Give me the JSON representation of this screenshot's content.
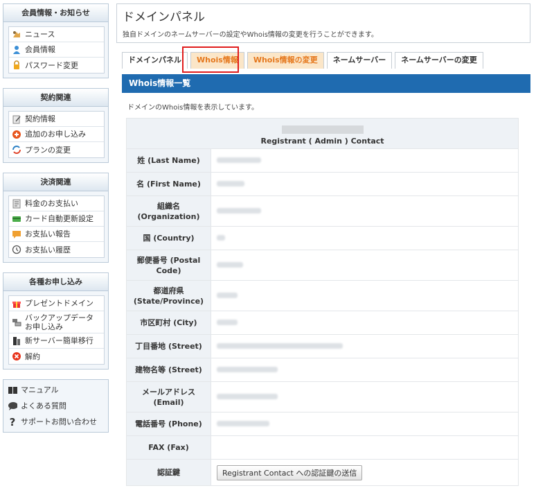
{
  "sidebar": {
    "sections": [
      {
        "title": "会員情報・お知らせ",
        "items": [
          {
            "label": "ニュース",
            "icon": "news-icon"
          },
          {
            "label": "会員情報",
            "icon": "user-icon"
          },
          {
            "label": "パスワード変更",
            "icon": "lock-icon"
          }
        ]
      },
      {
        "title": "契約関連",
        "items": [
          {
            "label": "契約情報",
            "icon": "contract-icon"
          },
          {
            "label": "追加のお申し込み",
            "icon": "add-icon"
          },
          {
            "label": "プランの変更",
            "icon": "refresh-icon"
          }
        ]
      },
      {
        "title": "決済関連",
        "items": [
          {
            "label": "料金のお支払い",
            "icon": "invoice-icon"
          },
          {
            "label": "カード自動更新設定",
            "icon": "card-icon"
          },
          {
            "label": "お支払い報告",
            "icon": "report-icon"
          },
          {
            "label": "お支払い履歴",
            "icon": "history-icon"
          }
        ]
      },
      {
        "title": "各種お申し込み",
        "items": [
          {
            "label": "プレゼントドメイン",
            "icon": "gift-icon"
          },
          {
            "label": "バックアップデータ\nお申し込み",
            "icon": "backup-icon"
          },
          {
            "label": "新サーバー簡単移行",
            "icon": "server-icon"
          },
          {
            "label": "解約",
            "icon": "cancel-icon"
          }
        ]
      }
    ],
    "support": [
      {
        "label": "マニュアル",
        "icon": "book-icon"
      },
      {
        "label": "よくある質問",
        "icon": "faq-icon"
      },
      {
        "label": "サポートお問い合わせ",
        "icon": "question-icon"
      }
    ]
  },
  "header": {
    "title": "ドメインパネル",
    "description": "独自ドメインのネームサーバーの設定やWhois情報の変更を行うことができます。"
  },
  "tabs": [
    {
      "label": "ドメインパネル"
    },
    {
      "label": "Whois情報"
    },
    {
      "label": "Whois情報の変更"
    },
    {
      "label": "ネームサーバー"
    },
    {
      "label": "ネームサーバーの変更"
    }
  ],
  "panel": {
    "title": "Whois情報一覧",
    "description": "ドメインのWhois情報を表示しています。"
  },
  "whois": {
    "contact_heading": "Registrant ( Admin ) Contact",
    "rows": [
      {
        "label": "姓 (Last Name)"
      },
      {
        "label": "名 (First Name)"
      },
      {
        "label": "組織名 (Organization)"
      },
      {
        "label": "国 (Country)"
      },
      {
        "label": "郵便番号 (Postal Code)"
      },
      {
        "label": "都道府県 (State/Province)"
      },
      {
        "label": "市区町村 (City)"
      },
      {
        "label": "丁目番地 (Street)"
      },
      {
        "label": "建物名等 (Street)"
      },
      {
        "label": "メールアドレス (Email)"
      },
      {
        "label": "電話番号 (Phone)"
      },
      {
        "label": "FAX (Fax)"
      }
    ],
    "auth_label": "認証鍵",
    "auth_button": "Registrant Contact への認証鍵の送信"
  },
  "colors": {
    "panel_header": "#1f6bb0",
    "tab_active_bg": "#fbe6c8",
    "tab_active_text": "#e5781d",
    "highlight": "#e01c1c"
  }
}
